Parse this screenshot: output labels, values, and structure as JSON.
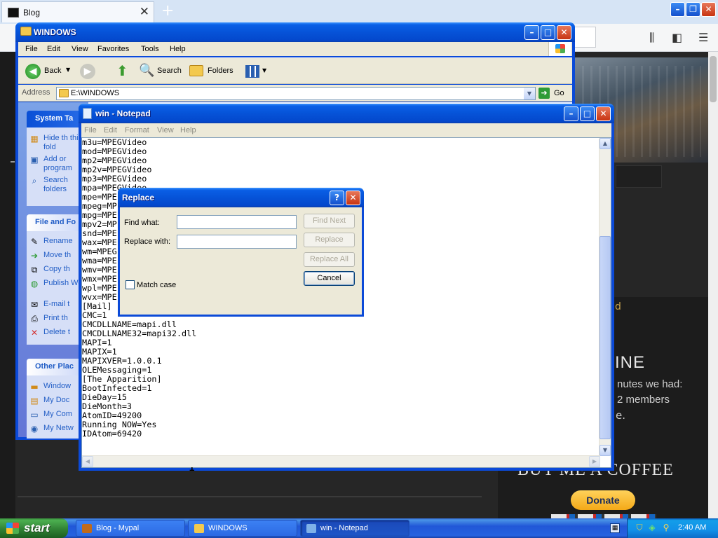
{
  "firefox": {
    "tab_title": "Blog",
    "tab_close": "✕",
    "new_tab": "+"
  },
  "webpage": {
    "heading_online": "INE",
    "minutes_text": "nutes we had:",
    "members_text": "2 members",
    "dot_text": "e.",
    "d_text": "d",
    "coffee_text": "BUY ME A COFFEE",
    "donate_label": "Donate"
  },
  "explorer": {
    "title": "WINDOWS",
    "menu": [
      "File",
      "Edit",
      "View",
      "Favorites",
      "Tools",
      "Help"
    ],
    "toolbar": {
      "back": "Back",
      "search": "Search",
      "folders": "Folders"
    },
    "address_label": "Address",
    "address_value": "E:\\WINDOWS",
    "go_label": "Go",
    "taskpane": {
      "system_tasks": "System Ta",
      "system_links": [
        "Hide th this fold",
        "Add or program",
        "Search folders"
      ],
      "file_folder": "File and Fo",
      "file_links": [
        "Rename",
        "Move th",
        "Copy th",
        "Publish Web",
        "E-mail t",
        "Print th",
        "Delete t"
      ],
      "other_places": "Other Plac",
      "other_links": [
        "Window",
        "My Doc",
        "My Com",
        "My Netw"
      ]
    }
  },
  "notepad": {
    "title": "win - Notepad",
    "menu": [
      "File",
      "Edit",
      "Format",
      "View",
      "Help"
    ],
    "lines": [
      "m3u=MPEGVideo",
      "mod=MPEGVideo",
      "mp2=MPEGVideo",
      "mp2v=MPEGVideo",
      "mp3=MPEGVideo",
      "mpa=MPEGVideo",
      "mpe=MPE",
      "mpeg=MP",
      "mpg=MPE",
      "mpv2=MP",
      "snd=MPE",
      "wax=MPE",
      "wm=MPEG",
      "wma=MPE",
      "wmv=MPE",
      "wmx=MPE",
      "wpl=MPE",
      "wvx=MPE",
      "[Mail]",
      "CMC=1",
      "CMCDLLNAME=mapi.dll",
      "CMCDLLNAME32=mapi32.dll",
      "MAPI=1",
      "MAPIX=1",
      "MAPIXVER=1.0.0.1",
      "OLEMessaging=1",
      "[The Apparition]",
      "BootInfected=1",
      "DieDay=15",
      "DieMonth=3",
      "AtomID=49200",
      "Running NOW=Yes",
      "IDAtom=69420"
    ]
  },
  "replace_dialog": {
    "title": "Replace",
    "find_label": "Find what:",
    "replace_label": "Replace with:",
    "find_value": "",
    "replace_value": "",
    "find_next": "Find Next",
    "replace": "Replace",
    "replace_all": "Replace All",
    "cancel": "Cancel",
    "match_case": "Match case",
    "help": "?",
    "close": "✕"
  },
  "taskbar": {
    "start": "start",
    "tasks": [
      {
        "label": "Blog - Mypal",
        "icon_color": "#c06a1c"
      },
      {
        "label": "WINDOWS",
        "icon_color": "#f3c94e"
      },
      {
        "label": "win - Notepad",
        "icon_color": "#7fb1e8"
      }
    ],
    "clock": "2:40 AM"
  },
  "colors": {
    "xp_blue": "#0653d8",
    "taskbar_blue": "#2157d7",
    "start_green": "#2e7d32",
    "donate_yellow": "#f4a918"
  }
}
